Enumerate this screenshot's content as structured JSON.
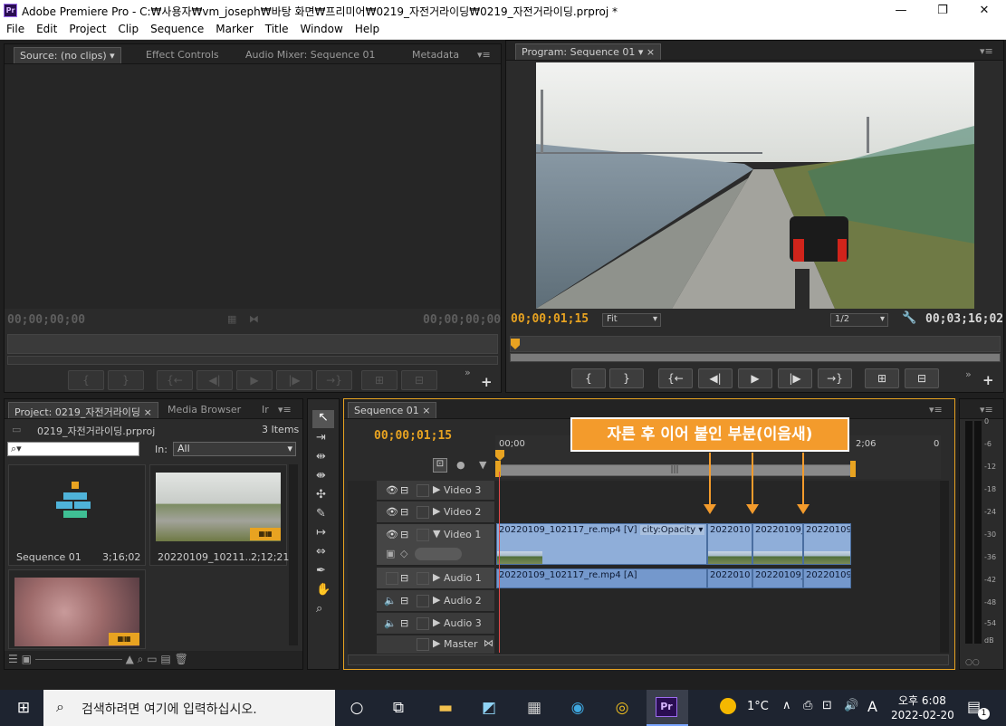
{
  "window": {
    "title": "Adobe Premiere Pro - C:₩사용자₩vm_joseph₩바탕 화면₩프리미어₩0219_자전거라이딩₩0219_자전거라이딩.prproj *",
    "app_icon": "Pr"
  },
  "menu": [
    "File",
    "Edit",
    "Project",
    "Clip",
    "Sequence",
    "Marker",
    "Title",
    "Window",
    "Help"
  ],
  "source_panel": {
    "tabs": [
      "Source: (no clips)",
      "Effect Controls",
      "Audio Mixer: Sequence 01",
      "Metadata"
    ],
    "timecode_left": "00;00;00;00",
    "timecode_right": "00;00;00;00"
  },
  "program_panel": {
    "tab": "Program: Sequence 01",
    "timecode_current": "00;00;01;15",
    "zoom": "Fit",
    "resolution": "1/2",
    "duration": "00;03;16;02"
  },
  "project_panel": {
    "tabs": [
      "Project: 0219_자전거라이딩",
      "Media Browser",
      "Ir"
    ],
    "project_file": "0219_자전거라이딩.prproj",
    "item_count": "3 Items",
    "in_label": "In:",
    "in_value": "All",
    "items": [
      {
        "name": "Sequence 01",
        "duration": "3;16;02"
      },
      {
        "name": "20220109_10211...",
        "duration": "2;12;21"
      },
      {
        "name": "",
        "duration": ""
      }
    ]
  },
  "timeline": {
    "tab": "Sequence 01",
    "timecode": "00;00;01;15",
    "ruler_start": "00;00",
    "ruler_mid": "2;06",
    "ruler_end": "0",
    "tracks": [
      "Video 3",
      "Video 2",
      "Video 1",
      "Audio 1",
      "Audio 2",
      "Audio 3",
      "Master"
    ],
    "video_clip_main": "20220109_102117_re.mp4 [V]",
    "opacity_label": "city:Opacity ▾",
    "video_clip_2": "2022010",
    "video_clip_3": "20220109_",
    "video_clip_4": "20220109",
    "audio_clip_main": "20220109_102117_re.mp4 [A]",
    "audio_clip_2": "2022010",
    "audio_clip_3": "20220109_",
    "audio_clip_4": "20220109"
  },
  "annotation": "자른 후 이어 붙인 부분(이음새)",
  "audio_meter": {
    "labels": [
      "0",
      "-6",
      "-12",
      "-18",
      "-24",
      "-30",
      "-36",
      "-42",
      "-48",
      "-54",
      "dB"
    ]
  },
  "taskbar": {
    "search_placeholder": "검색하려면 여기에 입력하십시오.",
    "weather": "1°C",
    "ime": "A",
    "time": "오후 6:08",
    "date": "2022-02-20",
    "notification_count": "1"
  },
  "colors": {
    "accent_orange": "#f39b2c",
    "timecode_orange": "#e8a321",
    "clip_blue": "#8faed9"
  }
}
